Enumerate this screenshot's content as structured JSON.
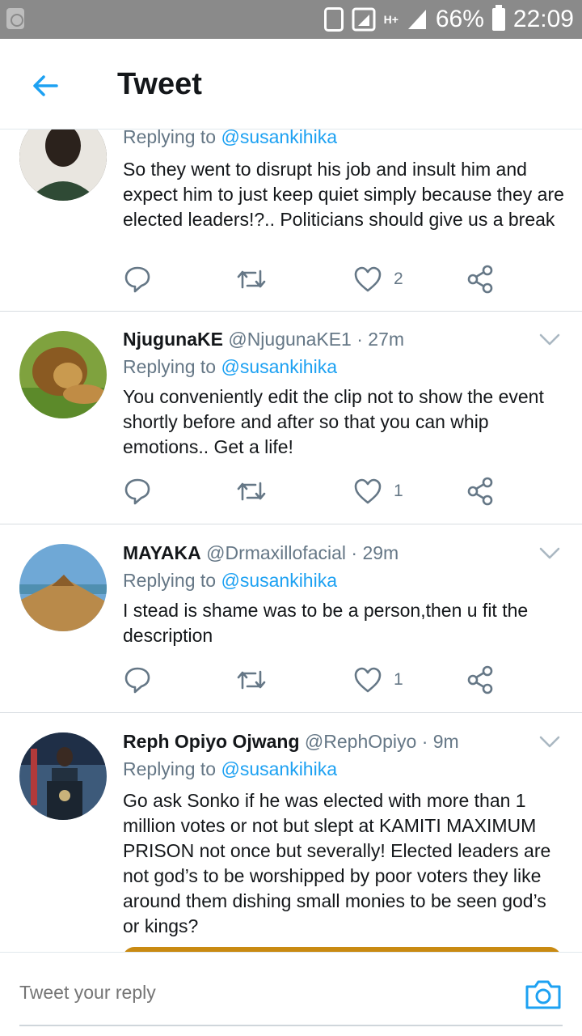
{
  "status_bar": {
    "battery": "66%",
    "time": "22:09",
    "network": "H+",
    "icons": [
      "recycle-icon",
      "phone-icon",
      "signal-icon",
      "cell-signal-icon",
      "battery-icon"
    ]
  },
  "header": {
    "title": "Tweet",
    "back_icon": "arrow-left-icon",
    "accent": "#1da1f2"
  },
  "tweets": [
    {
      "name": "",
      "handle": "",
      "time": "",
      "replying_prefix": "Replying to ",
      "replying_to": "@susankihika",
      "text": "So they went to disrupt his job and insult him and expect him to just keep quiet simply because they are elected leaders!?.. Politicians should give us a break",
      "likes": "2"
    },
    {
      "name": "NjugunaKE",
      "handle": "@NjugunaKE1",
      "time": "· 27m",
      "replying_prefix": "Replying to ",
      "replying_to": "@susankihika",
      "text": "You conveniently edit the clip not to show the event shortly before and after so that you can whip emotions.. Get a life!",
      "likes": "1"
    },
    {
      "name": "MAYAKA",
      "handle": "@Drmaxillofacial",
      "time": "· 29m",
      "replying_prefix": "Replying to ",
      "replying_to": "@susankihika",
      "text": "I stead is shame was to be a person,then u fit the description",
      "likes": "1"
    },
    {
      "name": "Reph Opiyo Ojwang",
      "handle": "@RephOpiyo",
      "time": "· 9m",
      "replying_prefix": "Replying to ",
      "replying_to": "@susankihika",
      "text": "Go ask Sonko if he was elected with more than 1 million votes or not but slept at KAMITI MAXIMUM PRISON not once but severally! Elected leaders are not god’s to be worshipped by poor voters they like around them dishing small monies to be seen god’s or kings?",
      "likes": ""
    }
  ],
  "reply_bar": {
    "placeholder": "Tweet your reply",
    "camera_icon": "camera-icon"
  }
}
